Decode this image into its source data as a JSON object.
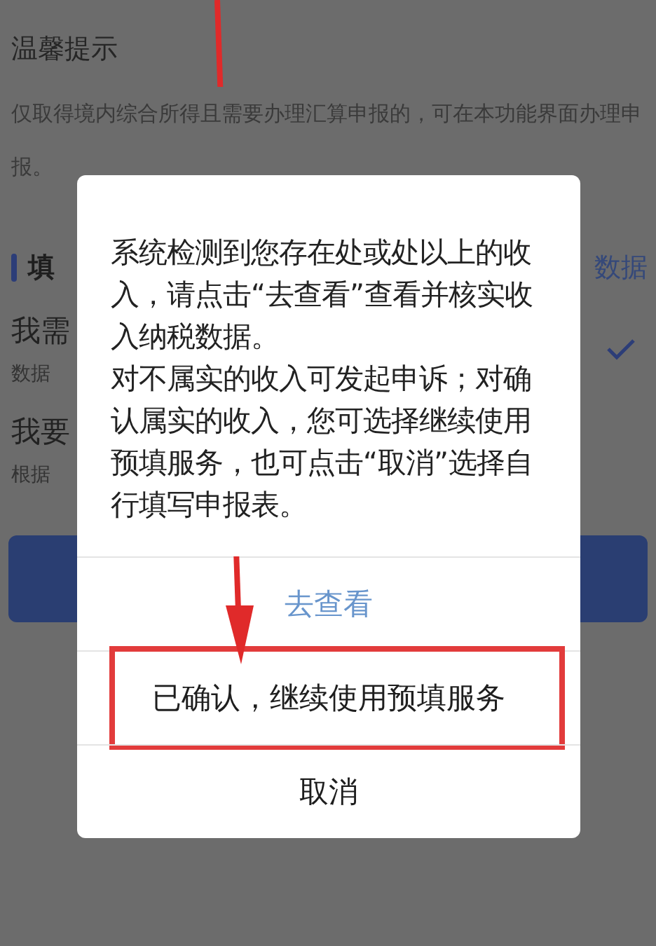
{
  "notice": {
    "title": "温馨提示",
    "text": "仅取得境内综合所得且需要办理汇算申报的，可在本功能界面办理申报。"
  },
  "section": {
    "title": "填",
    "link": "数据"
  },
  "options": [
    {
      "title": "我需",
      "subtitle": "数据",
      "checked": true
    },
    {
      "title": "我要",
      "subtitle": "根据",
      "checked": false
    }
  ],
  "dialog": {
    "message": [
      "系统检测到您存在处或处以上的收入，请点击“去查看”查看并核实收入纳税数据。",
      "对不属实的收入可发起申诉；对确认属实的收入，您可选择继续使用预填服务，也可点击“取消”选择自行填写申报表。"
    ],
    "buttons": [
      {
        "label": "去查看",
        "kind": "link",
        "highlighted": false
      },
      {
        "label": "已确认，继续使用预填服务",
        "kind": "plain",
        "highlighted": true
      },
      {
        "label": "取消",
        "kind": "plain",
        "highlighted": false
      }
    ]
  }
}
